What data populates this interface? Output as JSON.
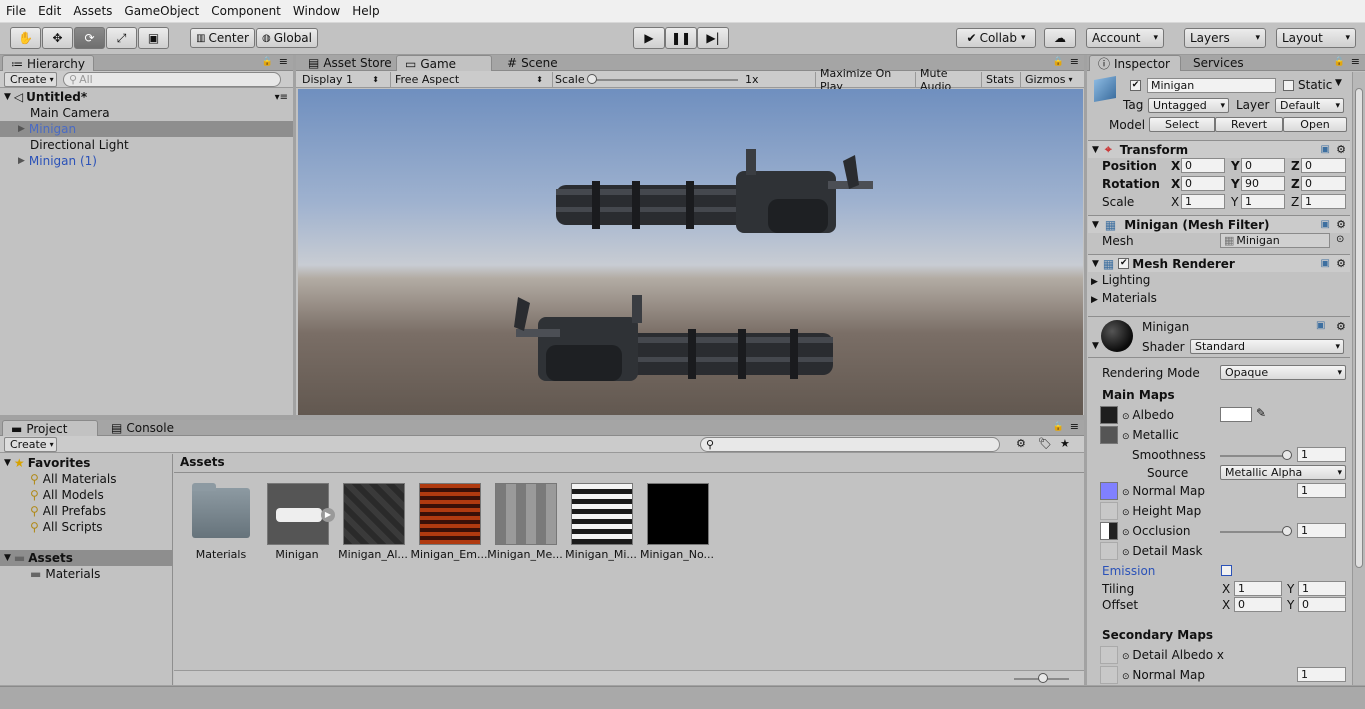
{
  "menu": [
    "File",
    "Edit",
    "Assets",
    "GameObject",
    "Component",
    "Window",
    "Help"
  ],
  "toolbar": {
    "tools": [
      "hand-icon",
      "move-icon",
      "rotate-icon",
      "scale-icon",
      "rect-icon"
    ],
    "center": "Center",
    "global": "Global",
    "collab": "Collab",
    "account": "Account",
    "layers": "Layers",
    "layout": "Layout"
  },
  "hierarchy": {
    "tab": "Hierarchy",
    "create": "Create",
    "search_placeholder": "All",
    "scene": "Untitled*",
    "items": [
      "Main Camera",
      "Minigan",
      "Directional Light",
      "Minigan (1)"
    ]
  },
  "game": {
    "tabs": [
      "Asset Store",
      "Game",
      "Scene"
    ],
    "display": "Display 1",
    "aspect": "Free Aspect",
    "scale_label": "Scale",
    "scale_value": "1x",
    "options": [
      "Maximize On Play",
      "Mute Audio",
      "Stats",
      "Gizmos"
    ]
  },
  "project": {
    "tabs": [
      "Project",
      "Console"
    ],
    "create": "Create",
    "favorites": "Favorites",
    "favorite_items": [
      "All Materials",
      "All Models",
      "All Prefabs",
      "All Scripts"
    ],
    "assets_root": "Assets",
    "assets_children": [
      "Materials"
    ],
    "breadcrumb": "Assets",
    "assets": [
      "Materials",
      "Minigan",
      "Minigan_Al...",
      "Minigan_Em...",
      "Minigan_Me...",
      "Minigan_Mi...",
      "Minigan_No..."
    ]
  },
  "inspector": {
    "tabs": [
      "Inspector",
      "Services"
    ],
    "name": "Minigan",
    "static": "Static",
    "tag_label": "Tag",
    "tag": "Untagged",
    "layer_label": "Layer",
    "layer": "Default",
    "model_label": "Model",
    "model_buttons": [
      "Select",
      "Revert",
      "Open"
    ],
    "transform": {
      "title": "Transform",
      "position_label": "Position",
      "rotation_label": "Rotation",
      "scale_label": "Scale",
      "position": [
        "0",
        "0",
        "0"
      ],
      "rotation": [
        "0",
        "90",
        "0"
      ],
      "scale": [
        "1",
        "1",
        "1"
      ],
      "axes": [
        "X",
        "Y",
        "Z"
      ]
    },
    "mesh_filter": {
      "title": "Minigan (Mesh Filter)",
      "mesh_label": "Mesh",
      "mesh": "Minigan"
    },
    "mesh_renderer": {
      "title": "Mesh Renderer",
      "lighting": "Lighting",
      "materials": "Materials"
    },
    "material": {
      "name": "Minigan",
      "shader_label": "Shader",
      "shader": "Standard",
      "rendering_mode_label": "Rendering Mode",
      "rendering_mode": "Opaque",
      "main_maps": "Main Maps",
      "albedo": "Albedo",
      "metallic": "Metallic",
      "smoothness": "Smoothness",
      "smoothness_value": "1",
      "source_label": "Source",
      "source": "Metallic Alpha",
      "normal_map": "Normal Map",
      "normal_value": "1",
      "height_map": "Height Map",
      "occlusion": "Occlusion",
      "occlusion_value": "1",
      "detail_mask": "Detail Mask",
      "emission": "Emission",
      "tiling_label": "Tiling",
      "tiling": [
        "1",
        "1"
      ],
      "offset_label": "Offset",
      "offset": [
        "0",
        "0"
      ],
      "secondary_maps": "Secondary Maps",
      "detail_albedo": "Detail Albedo x",
      "normal_map2": "Normal Map",
      "normal_value2": "1"
    }
  },
  "colors": {
    "selection": "#8e8e8e",
    "link_blue": "#2b52b8",
    "sky": "#aebcd3",
    "ground": "#6a5e57"
  }
}
